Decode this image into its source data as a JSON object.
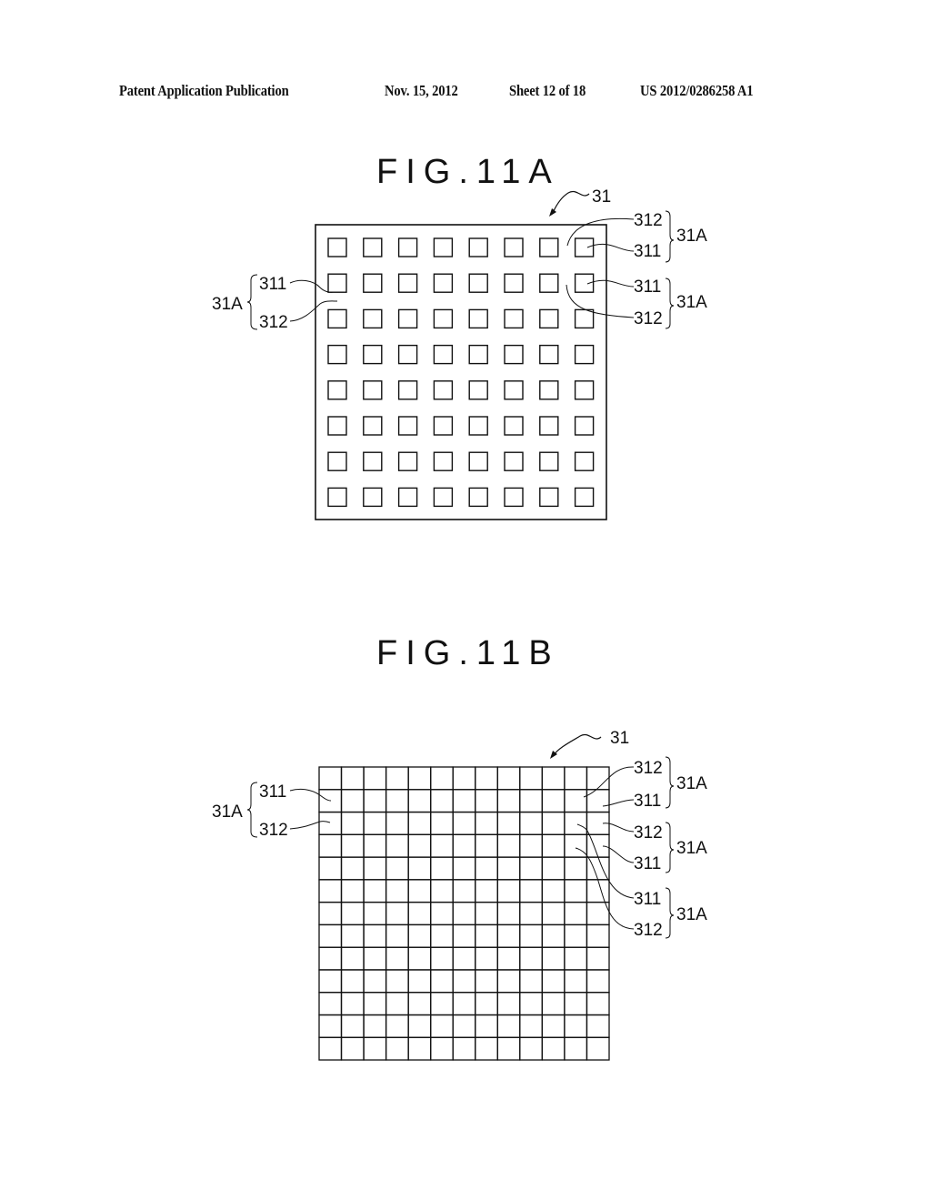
{
  "header": {
    "publication": "Patent Application Publication",
    "date": "Nov. 15, 2012",
    "sheet": "Sheet 12 of 18",
    "number": "US 2012/0286258 A1"
  },
  "fig_a": {
    "title": "FIG.11A",
    "ref_main": "31",
    "grid": {
      "rows": 8,
      "cols": 8,
      "kind": "isolated-squares"
    },
    "labels": {
      "left_group": "31A",
      "left_311": "311",
      "left_312": "312",
      "right_top_312": "312",
      "right_top_311": "311",
      "right_top_group": "31A",
      "right_mid_311": "311",
      "right_mid_312": "312",
      "right_mid_group": "31A"
    }
  },
  "fig_b": {
    "title": "FIG.11B",
    "ref_main": "31",
    "grid": {
      "rows": 13,
      "cols": 13,
      "kind": "contiguous-cells"
    },
    "labels": {
      "left_group": "31A",
      "left_311": "311",
      "left_312": "312",
      "r1_312": "312",
      "r1_311": "311",
      "r1_group": "31A",
      "r2_312": "312",
      "r2_311": "311",
      "r2_group": "31A",
      "r3_311": "311",
      "r3_312": "312",
      "r3_group": "31A"
    }
  }
}
